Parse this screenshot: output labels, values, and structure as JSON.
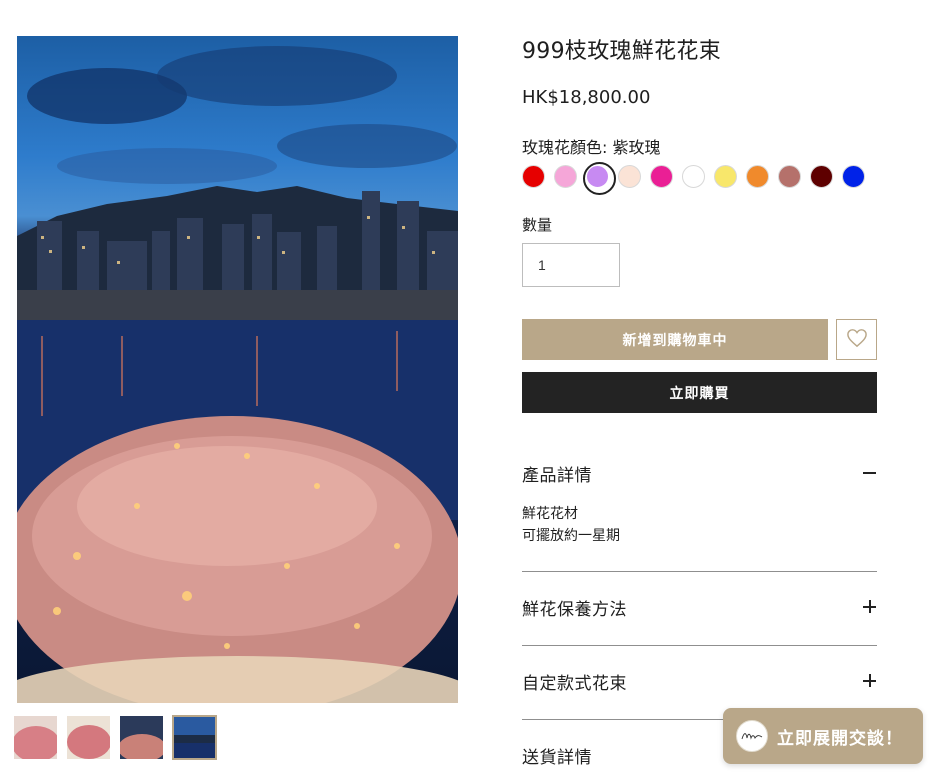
{
  "product": {
    "title": "999枝玫瑰鮮花花束",
    "price": "HK$18,800.00",
    "color_label": "玫瑰花顏色: 紫玫瑰",
    "colors": [
      "#e60000",
      "#f5a6d8",
      "#c78af2",
      "#fbe3d6",
      "#ea1f95",
      "#ffffff",
      "#f8e76b",
      "#f08a2c",
      "#b5716b",
      "#5e0000",
      "#0022e8"
    ],
    "selected_color_index": 2
  },
  "quantity": {
    "label": "數量",
    "value": "1"
  },
  "buttons": {
    "add_to_cart": "新增到購物車中",
    "buy_now": "立即購買"
  },
  "accordion": [
    {
      "title": "產品詳情",
      "expanded": true,
      "body": [
        "鮮花花材",
        "可擺放約一星期"
      ]
    },
    {
      "title": "鮮花保養方法",
      "expanded": false
    },
    {
      "title": "自定款式花束",
      "expanded": false
    },
    {
      "title": "送貨詳情",
      "expanded": false
    }
  ],
  "chat": {
    "label": "立即展開交談！"
  },
  "gallery": {
    "thumbnail_count": 4,
    "active_thumbnail": 3
  },
  "colors": {
    "accent": "#b9a789",
    "buy_button": "#232323"
  },
  "icons": {
    "wishlist": "heart-icon",
    "chat_logo": "brand-logo-icon"
  }
}
